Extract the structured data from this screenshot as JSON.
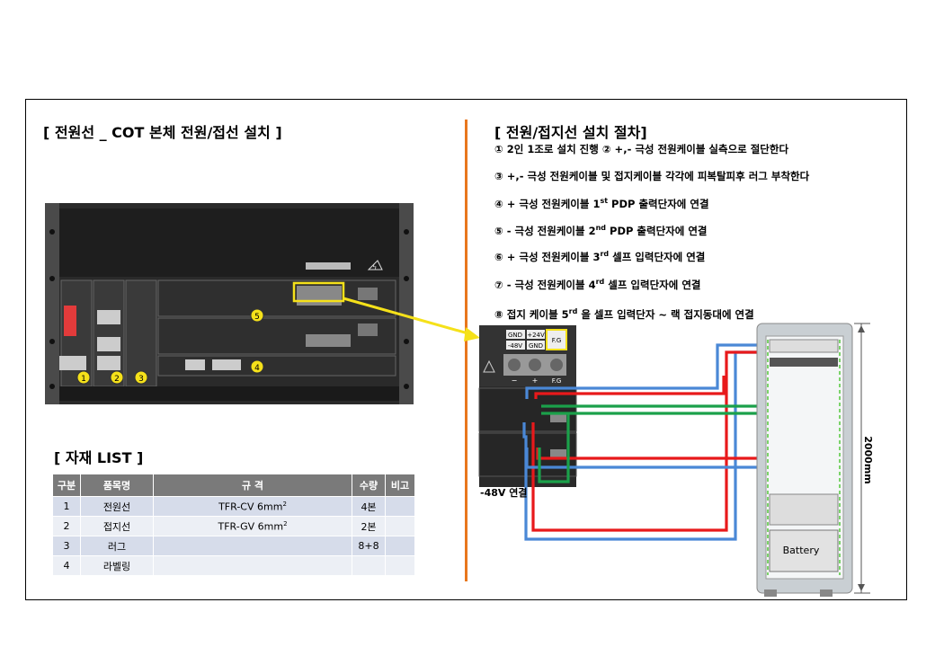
{
  "left_title": "[ 전원선 _ COT 본체 전원/접선 설치 ]",
  "right_title": "[ 전원/접지선 설치 절차]",
  "list_title": "[ 자재 LIST ]",
  "steps": [
    {
      "text": "① 2인 1조로 설치 진행        ② +,- 극성 전원케이블 실측으로 절단한다"
    },
    {
      "pre": "③ +,- 극성 전원케이블 및 접지케이블 각각에 피복탈피후 러그 부착한다",
      "sup": "",
      "post": ""
    },
    {
      "pre": "④ + 극성 전원케이블 1",
      "sup": "st",
      "post": " PDP 출력단자에 연결"
    },
    {
      "pre": "⑤ - 극성 전원케이블 2",
      "sup": "nd",
      "post": " PDP 출력단자에 연결"
    },
    {
      "pre": "⑥ + 극성 전원케이블 3",
      "sup": "rd",
      "post": " 셀프 입력단자에 연결"
    },
    {
      "pre": "⑦ - 극성 전원케이블 4",
      "sup": "rd",
      "post": " 셀프 입력단자에 연결"
    },
    {
      "pre": "⑧ 접지 케이블 5",
      "sup": "rd",
      "post": " 을 셀프 입력단자 ~ 랙 접지동대에  연결"
    }
  ],
  "table": {
    "headers": [
      "구분",
      "품목명",
      "규 격",
      "수량",
      "비고"
    ],
    "rows": [
      {
        "no": "1",
        "name": "전원선",
        "spec": "TFR-CV 6mm",
        "spec_sup": "2",
        "qty": "4본",
        "note": ""
      },
      {
        "no": "2",
        "name": "접지선",
        "spec": "TFR-GV 6mm",
        "spec_sup": "2",
        "qty": "2본",
        "note": ""
      },
      {
        "no": "3",
        "name": "러그",
        "spec": "",
        "spec_sup": "",
        "qty": "8+8",
        "note": ""
      },
      {
        "no": "4",
        "name": "라벨링",
        "spec": "",
        "spec_sup": "",
        "qty": "",
        "note": ""
      }
    ]
  },
  "markers": [
    "1",
    "2",
    "3",
    "4",
    "5"
  ],
  "terminal_labels": {
    "gnd": "GND",
    "plus24": "+24V",
    "minus48": "-48V",
    "gnd2": "GND",
    "fg": "F.G",
    "minus": "−",
    "plus": "+",
    "fg2": "F.G"
  },
  "rack_height_label": "2000mm",
  "battery_label": "Battery",
  "minus48_conn_label": "-48V 연결",
  "colors": {
    "accent": "#e8771e",
    "marker": "#f5e11a",
    "plus_wire": "#e8191b",
    "minus_wire": "#4a88d6",
    "ground_wire": "#1ba04a"
  }
}
